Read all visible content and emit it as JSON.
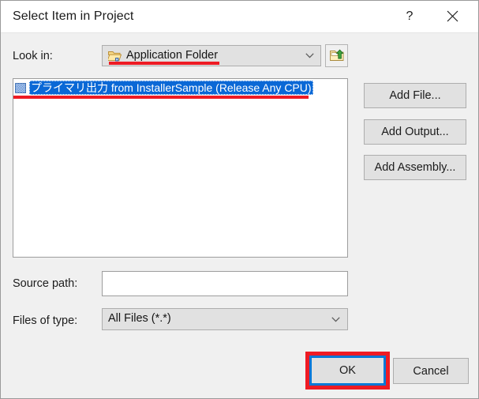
{
  "window": {
    "title": "Select Item in Project",
    "help_icon": "question-mark-icon",
    "close_icon": "close-x-icon"
  },
  "look_in": {
    "label": "Look in:",
    "value": "Application Folder",
    "icon": "open-folder-icon",
    "chevron": "chevron-down-icon",
    "up_button_icon": "folder-up-arrow-icon"
  },
  "list": {
    "items": [
      {
        "label": "プライマリ出力 from InstallerSample (Release Any CPU)",
        "icon": "project-output-icon",
        "selected": true
      }
    ]
  },
  "side_buttons": {
    "add_file": "Add File...",
    "add_output": "Add Output...",
    "add_assembly": "Add Assembly..."
  },
  "source_path": {
    "label": "Source path:",
    "value": "",
    "placeholder": ""
  },
  "files_of_type": {
    "label": "Files of type:",
    "value": "All Files (*.*)",
    "chevron": "chevron-down-icon"
  },
  "footer": {
    "ok": "OK",
    "cancel": "Cancel"
  },
  "colors": {
    "dialog_background": "#f0f0f0",
    "titlebar_background": "#ffffff",
    "selection_blue": "#0a68d6",
    "focus_blue": "#0078d7",
    "annotation_red": "#ee1b24",
    "control_face": "#e1e1e1"
  }
}
